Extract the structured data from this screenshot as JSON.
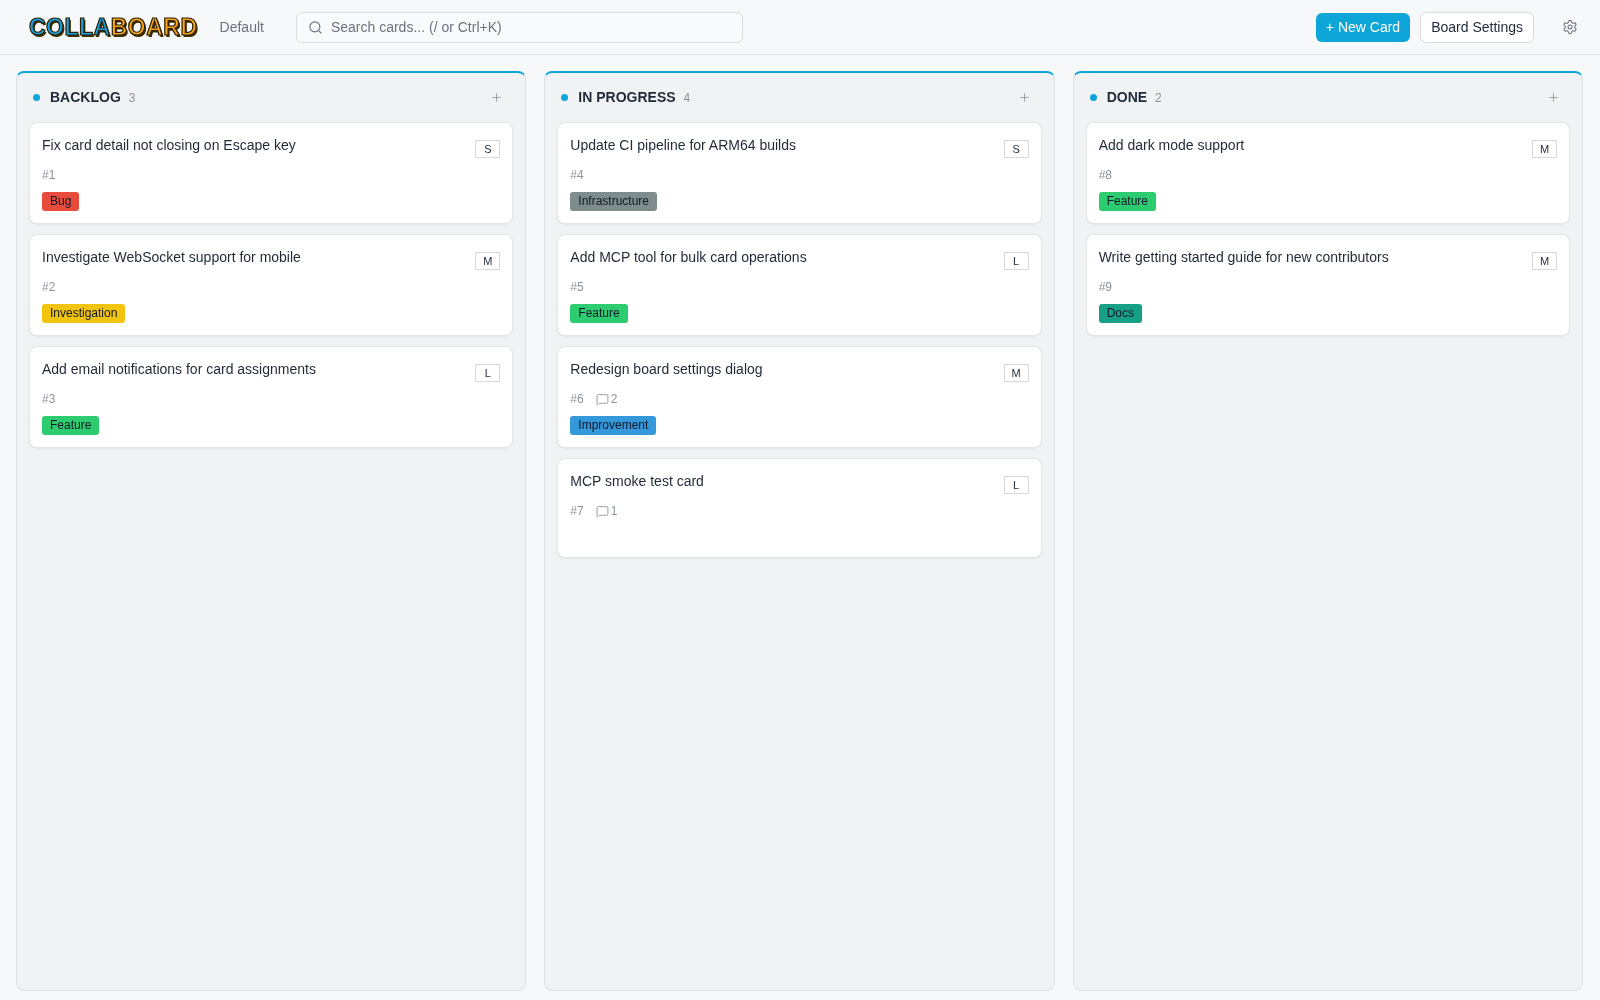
{
  "header": {
    "logo": [
      {
        "text": "COLLA",
        "color": "#1ba0e2"
      },
      {
        "text": "BOARD",
        "color": "#f7a21b"
      }
    ],
    "board_name": "Default",
    "search": {
      "placeholder": "Search cards... (/ or Ctrl+K)"
    },
    "buttons": [
      {
        "kind": "primary",
        "label": "+ New Card"
      },
      {
        "kind": "secondary",
        "label": "Board Settings"
      }
    ]
  },
  "columns": [
    {
      "title": "BACKLOG",
      "count": "3",
      "cards": [
        {
          "title": "Fix card detail not closing on Escape key",
          "number": "#1",
          "size": "S",
          "tag": {
            "label": "Bug",
            "color": "#e74c3c"
          }
        },
        {
          "title": "Investigate WebSocket support for mobile",
          "number": "#2",
          "size": "M",
          "tag": {
            "label": "Investigation",
            "color": "#f1c40f"
          }
        },
        {
          "title": "Add email notifications for card assignments",
          "number": "#3",
          "size": "L",
          "tag": {
            "label": "Feature",
            "color": "#2ecc71"
          }
        }
      ]
    },
    {
      "title": "IN PROGRESS",
      "count": "4",
      "cards": [
        {
          "title": "Update CI pipeline for ARM64 builds",
          "number": "#4",
          "size": "S",
          "tag": {
            "label": "Infrastructure",
            "color": "#7f8c8d"
          }
        },
        {
          "title": "Add MCP tool for bulk card operations",
          "number": "#5",
          "size": "L",
          "tag": {
            "label": "Feature",
            "color": "#2ecc71"
          }
        },
        {
          "title": "Redesign board settings dialog",
          "number": "#6",
          "size": "M",
          "comments": "2",
          "tag": {
            "label": "Improvement",
            "color": "#3498db"
          }
        },
        {
          "title": "MCP smoke test card",
          "number": "#7",
          "size": "L",
          "comments": "1"
        }
      ]
    },
    {
      "title": "DONE",
      "count": "2",
      "cards": [
        {
          "title": "Add dark mode support",
          "number": "#8",
          "size": "M",
          "tag": {
            "label": "Feature",
            "color": "#2ecc71"
          }
        },
        {
          "title": "Write getting started guide for new contributors",
          "number": "#9",
          "size": "M",
          "tag": {
            "label": "Docs",
            "color": "#16a085"
          }
        }
      ]
    }
  ]
}
